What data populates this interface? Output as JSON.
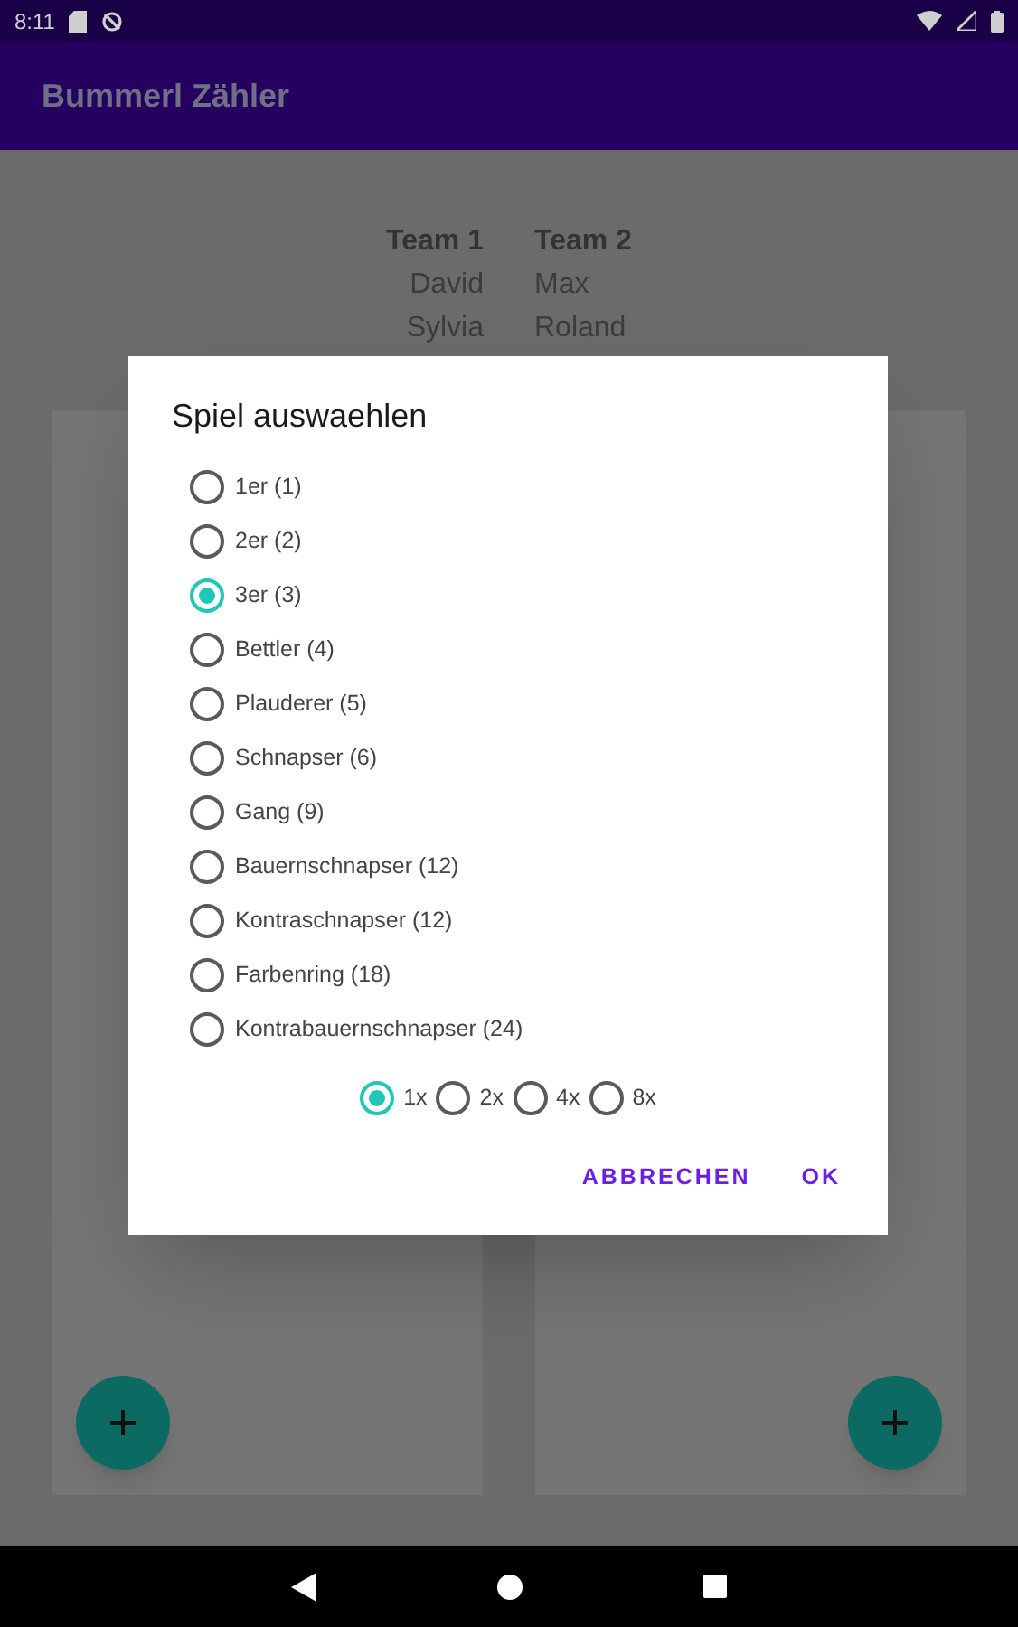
{
  "status_bar": {
    "time": "8:11"
  },
  "app_bar": {
    "title": "Bummerl Zähler"
  },
  "teams": [
    {
      "name": "Team 1",
      "players": [
        "David",
        "Sylvia"
      ]
    },
    {
      "name": "Team 2",
      "players": [
        "Max",
        "Roland"
      ]
    }
  ],
  "dialog": {
    "title": "Spiel auswaehlen",
    "games": [
      {
        "label": "1er (1)",
        "selected": false
      },
      {
        "label": "2er (2)",
        "selected": false
      },
      {
        "label": "3er (3)",
        "selected": true
      },
      {
        "label": "Bettler (4)",
        "selected": false
      },
      {
        "label": "Plauderer (5)",
        "selected": false
      },
      {
        "label": "Schnapser (6)",
        "selected": false
      },
      {
        "label": "Gang (9)",
        "selected": false
      },
      {
        "label": "Bauernschnapser (12)",
        "selected": false
      },
      {
        "label": "Kontraschnapser (12)",
        "selected": false
      },
      {
        "label": "Farbenring (18)",
        "selected": false
      },
      {
        "label": "Kontrabauernschnapser (24)",
        "selected": false
      }
    ],
    "multipliers": [
      {
        "label": "1x",
        "selected": true
      },
      {
        "label": "2x",
        "selected": false
      },
      {
        "label": "4x",
        "selected": false
      },
      {
        "label": "8x",
        "selected": false
      }
    ],
    "buttons": [
      "ABBRECHEN",
      "OK"
    ]
  }
}
